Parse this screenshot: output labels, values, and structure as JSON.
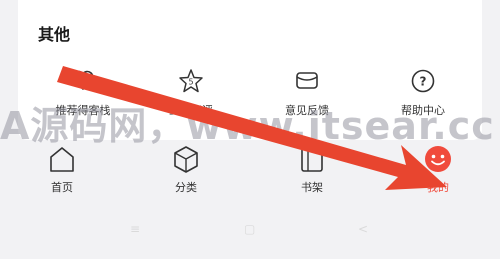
{
  "section": {
    "title": "其他"
  },
  "tools": [
    {
      "label": "推荐得客栈",
      "icon": "heart-icon"
    },
    {
      "label": "五星好评",
      "icon": "star-badge-icon"
    },
    {
      "label": "意见反馈",
      "icon": "feedback-box-icon"
    },
    {
      "label": "帮助中心",
      "icon": "help-circle-icon"
    }
  ],
  "tabs": [
    {
      "label": "首页",
      "icon": "home-icon",
      "active": false
    },
    {
      "label": "分类",
      "icon": "category-cube-icon",
      "active": false
    },
    {
      "label": "书架",
      "icon": "bookshelf-icon",
      "active": false
    },
    {
      "label": "我的",
      "icon": "smile-avatar-icon",
      "active": true
    }
  ],
  "navbar": {
    "menu": "≡",
    "home": "▢",
    "back": "<"
  },
  "watermark": "A源码网，www.itsear.cc",
  "colors": {
    "accent": "#f04b3c",
    "arrow": "#e8452f",
    "card": "#ffffff",
    "background": "#f2f2f4"
  }
}
